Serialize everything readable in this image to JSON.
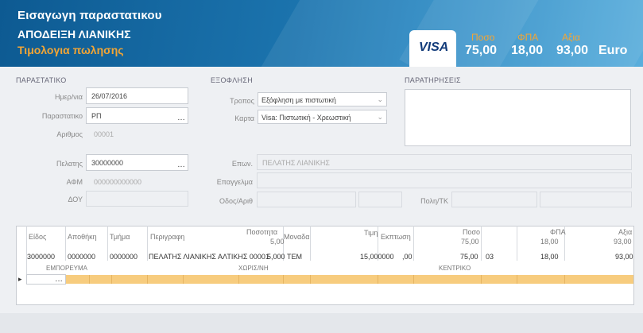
{
  "header": {
    "title": "Εισαγωγη παραστατικου",
    "doc_type": "ΑΠΟΔΕΙΞΗ ΛΙΑΝΙΚΗΣ",
    "pricing": "Τιμολογια πωλησης",
    "card": "VISA",
    "totals": {
      "sum_label": "Ποσο",
      "sum_value": "75,00",
      "vat_label": "ΦΠΑ",
      "vat_value": "18,00",
      "total_label": "Αξια",
      "total_value": "93,00",
      "currency": "Euro"
    },
    "colors": {
      "brand_blue": "#1b6fa8",
      "accent_orange": "#f3a534"
    }
  },
  "document": {
    "section": "ΠΑΡΑΣΤΑΤΙΚΟ",
    "date_label": "Ημερ/νια",
    "date_value": "26/07/2016",
    "series_label": "Παραστατικο",
    "series_value": "ΡΠ",
    "number_label": "Αριθμος",
    "number_value": "00001",
    "customer_label": "Πελατης",
    "customer_value": "30000000",
    "afm_label": "ΑΦΜ",
    "afm_value": "000000000000",
    "doy_label": "ΔΟΥ"
  },
  "payment": {
    "section": "ΕΞΟΦΛΗΣΗ",
    "method_label": "Τροπος",
    "method_value": "Εξόφληση με πιστωτική",
    "card_label": "Καρτα",
    "card_value": "Visa: Πιστωτική - Χρεωστική"
  },
  "notes": {
    "section": "ΠΑΡΑΤΗΡΗΣΕΙΣ"
  },
  "customer": {
    "name_label": "Επων.",
    "name_value": "ΠΕΛΑΤΗΣ ΛΙΑΝΙΚΗΣ",
    "occupation_label": "Επαγγελμα",
    "address_label": "Οδος/Αριθ",
    "city_label": "Πολη/ΤΚ"
  },
  "grid": {
    "columns": [
      "Είδος",
      "Αποθήκη",
      "Τμήμα",
      "Περιγραφη",
      "Ποσοτητα",
      "Μοναδα",
      "Τιμη",
      "Εκπτωση",
      "Ποσο",
      "ΦΠΑ",
      "Αξια"
    ],
    "summary": {
      "quantity": "5,00",
      "sum": "75,00",
      "vat": "18,00",
      "total": "93,00"
    },
    "rows": [
      {
        "item": "3000000",
        "warehouse": "0000000",
        "dept": "0000000",
        "description": "ΠΕΛΑΤΗΣ ΛΙΑΝΙΚΗΣ ΑΛΤΙΚΗΣ 00001",
        "quantity": "5,000",
        "unit": "ΤΕΜ",
        "price": "15,000000",
        "discount": ",00",
        "sum": "75,00",
        "vat_code": "03",
        "vat": "18,00",
        "total": "93,00"
      }
    ],
    "sub_labels": {
      "merchant": "ΕΜΠΟΡΕΥΜΑ",
      "expense": "ΧΩΡΙΣ/ΝΗ",
      "center": "ΚΕΝΤΡΙΚΟ"
    },
    "row_marker": "▸"
  }
}
